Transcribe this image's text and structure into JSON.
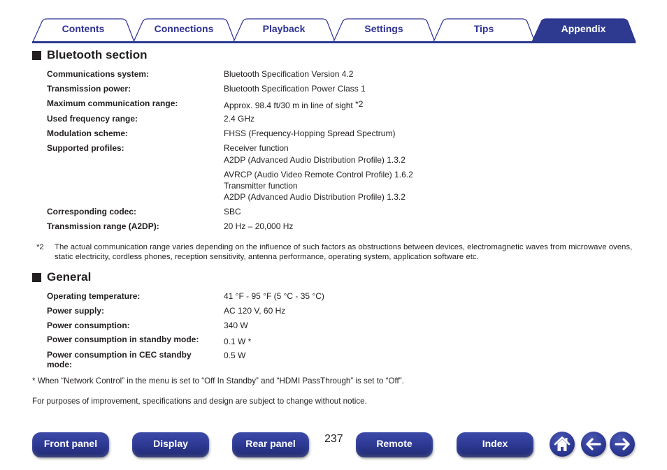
{
  "tabs": [
    {
      "label": "Contents",
      "active": false
    },
    {
      "label": "Connections",
      "active": false
    },
    {
      "label": "Playback",
      "active": false
    },
    {
      "label": "Settings",
      "active": false
    },
    {
      "label": "Tips",
      "active": false
    },
    {
      "label": "Appendix",
      "active": true
    }
  ],
  "colors": {
    "brand_blue": "#2e3192",
    "tab_line": "#2b3990",
    "text": "#231f20"
  },
  "bluetooth": {
    "title": "Bluetooth section",
    "rows": [
      {
        "label": "Communications system:",
        "value": "Bluetooth Specification Version 4.2"
      },
      {
        "label": "Transmission power:",
        "value": "Bluetooth Specification Power Class 1"
      },
      {
        "label": "Maximum communication range:",
        "value": "Approx. 98.4 ft/30 m in line of sight ",
        "note": "*2"
      },
      {
        "label": "Used frequency range:",
        "value": "2.4 GHz"
      },
      {
        "label": "Modulation scheme:",
        "value": "FHSS (Frequency-Hopping Spread Spectrum)"
      },
      {
        "label": "Supported profiles:",
        "lines": [
          "Receiver function",
          "A2DP (Advanced Audio Distribution Profile) 1.3.2",
          "AVRCP (Audio Video Remote Control Profile) 1.6.2",
          "Transmitter function",
          "A2DP (Advanced Audio Distribution Profile) 1.3.2"
        ]
      },
      {
        "label": "Corresponding codec:",
        "value": "SBC"
      },
      {
        "label": "Transmission range (A2DP):",
        "value": "20 Hz – 20,000 Hz"
      }
    ],
    "footnote": {
      "mark": "*2",
      "text": "The actual communication range varies depending on the influence of such factors as obstructions between devices, electromagnetic waves from microwave ovens, static electricity, cordless phones, reception sensitivity, antenna performance, operating system, application software etc."
    }
  },
  "general": {
    "title": "General",
    "rows": [
      {
        "label": "Operating temperature:",
        "value": "41 °F - 95 °F (5 °C - 35 °C)"
      },
      {
        "label": "Power supply:",
        "value": "AC 120 V, 60 Hz"
      },
      {
        "label": "Power consumption:",
        "value": "340 W"
      },
      {
        "label": "Power consumption in standby mode:",
        "value": "0.1 W *"
      },
      {
        "label": "Power consumption in CEC standby mode:",
        "value": "0.5 W"
      }
    ],
    "footnote": "* When “Network Control” in the menu is set to “Off In Standby” and “HDMI PassThrough” is set to “Off”."
  },
  "notice": "For purposes of improvement, specifications and design are subject to change without notice.",
  "footer": {
    "page_number": "237",
    "buttons": [
      {
        "label": "Front panel"
      },
      {
        "label": "Display"
      },
      {
        "label": "Rear panel"
      },
      {
        "label": "Remote"
      },
      {
        "label": "Index"
      }
    ],
    "icons": [
      "home-icon",
      "back-arrow-icon",
      "forward-arrow-icon"
    ]
  }
}
